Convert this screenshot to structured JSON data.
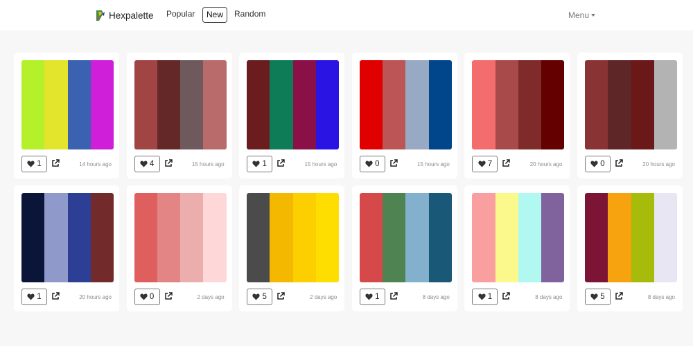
{
  "brand": {
    "name": "Hexpalette"
  },
  "nav": {
    "popular": "Popular",
    "new": "New",
    "random": "Random",
    "menu": "Menu"
  },
  "palettes": [
    {
      "colors": [
        "#b4f12a",
        "#e3e42c",
        "#3a62b0",
        "#cf1fd9"
      ],
      "likes": "1",
      "time": "14 hours ago"
    },
    {
      "colors": [
        "#a04444",
        "#652828",
        "#6e5a5c",
        "#b96a6a"
      ],
      "likes": "4",
      "time": "15 hours ago"
    },
    {
      "colors": [
        "#6b1c1e",
        "#0e7d57",
        "#8a1148",
        "#2914e3"
      ],
      "likes": "1",
      "time": "15 hours ago"
    },
    {
      "colors": [
        "#e00000",
        "#bb5556",
        "#98a9c3",
        "#01468b"
      ],
      "likes": "0",
      "time": "15 hours ago"
    },
    {
      "colors": [
        "#f46d6d",
        "#a84a4a",
        "#7f2a2b",
        "#650000"
      ],
      "likes": "7",
      "time": "20 hours ago"
    },
    {
      "colors": [
        "#8a3334",
        "#5e2626",
        "#6b1818",
        "#b3b3b3"
      ],
      "likes": "0",
      "time": "20 hours ago"
    },
    {
      "colors": [
        "#0b1538",
        "#8f9acb",
        "#2c3f95",
        "#722a2a"
      ],
      "likes": "1",
      "time": "20 hours ago"
    },
    {
      "colors": [
        "#df5f5f",
        "#e38585",
        "#ecaeac",
        "#fed8d8"
      ],
      "likes": "0",
      "time": "2 days ago"
    },
    {
      "colors": [
        "#4b4b4b",
        "#f4b800",
        "#fdcf01",
        "#fede00"
      ],
      "likes": "5",
      "time": "2 days ago"
    },
    {
      "colors": [
        "#d5494b",
        "#4f8351",
        "#83b1cd",
        "#1a5877"
      ],
      "likes": "1",
      "time": "8 days ago"
    },
    {
      "colors": [
        "#fa9f9f",
        "#fcf98c",
        "#b1f9f0",
        "#80629c"
      ],
      "likes": "1",
      "time": "8 days ago"
    },
    {
      "colors": [
        "#7c1535",
        "#f7a20f",
        "#a6bb0a",
        "#e8e6f2"
      ],
      "likes": "5",
      "time": "8 days ago"
    }
  ]
}
